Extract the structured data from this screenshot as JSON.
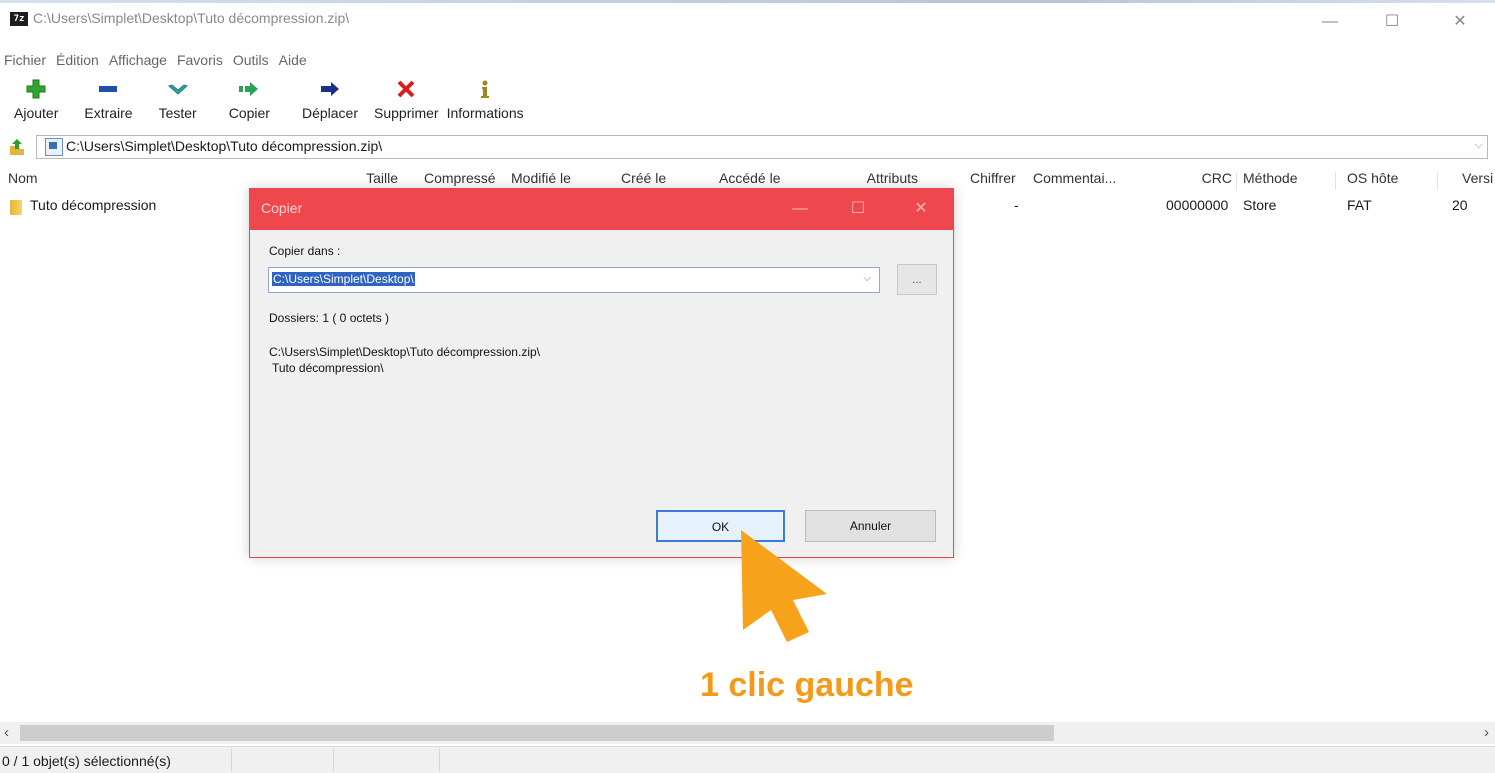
{
  "window": {
    "icon_text": "7z",
    "title": "C:\\Users\\Simplet\\Desktop\\Tuto décompression.zip\\",
    "minimize": "—",
    "maximize": "☐",
    "close": "✕"
  },
  "menu": [
    "Fichier",
    "Édition",
    "Affichage",
    "Favoris",
    "Outils",
    "Aide"
  ],
  "toolbar": [
    {
      "label": "Ajouter",
      "icon": "plus-icon",
      "color": "#2fa52f"
    },
    {
      "label": "Extraire",
      "icon": "minus-icon",
      "color": "#1f4fa8"
    },
    {
      "label": "Tester",
      "icon": "check-icon",
      "color": "#2aa6a0"
    },
    {
      "label": "Copier",
      "icon": "copy-arrow-icon",
      "color": "#2aa05a"
    },
    {
      "label": "Déplacer",
      "icon": "move-arrow-icon",
      "color": "#1a2f8a"
    },
    {
      "label": "Supprimer",
      "icon": "delete-x-icon",
      "color": "#d42020"
    },
    {
      "label": "Informations",
      "icon": "info-icon",
      "color": "#9a8a1a"
    }
  ],
  "address": {
    "path": "C:\\Users\\Simplet\\Desktop\\Tuto décompression.zip\\"
  },
  "columns": [
    "Nom",
    "Taille",
    "Compressé",
    "Modifié le",
    "Créé le",
    "Accédé le",
    "Attributs",
    "Chiffrer",
    "Commentai...",
    "CRC",
    "Méthode",
    "OS hôte",
    "Versi"
  ],
  "rows": [
    {
      "name": "Tuto décompression",
      "encrypted": "-",
      "crc": "00000000",
      "method": "Store",
      "host_os": "FAT",
      "version": "20"
    }
  ],
  "status": {
    "selection": "0 / 1 objet(s) sélectionné(s)"
  },
  "dialog": {
    "title": "Copier",
    "copy_to_label": "Copier dans :",
    "destination": "C:\\Users\\Simplet\\Desktop\\",
    "browse": "...",
    "summary": "Dossiers: 1   ( 0 octets )",
    "source_path": "C:\\Users\\Simplet\\Desktop\\Tuto décompression.zip\\",
    "source_item": "Tuto décompression\\",
    "ok": "OK",
    "cancel": "Annuler",
    "accent": "#ee484e"
  },
  "annotation": {
    "text": "1 clic gauche",
    "color": "#f49a1a"
  }
}
